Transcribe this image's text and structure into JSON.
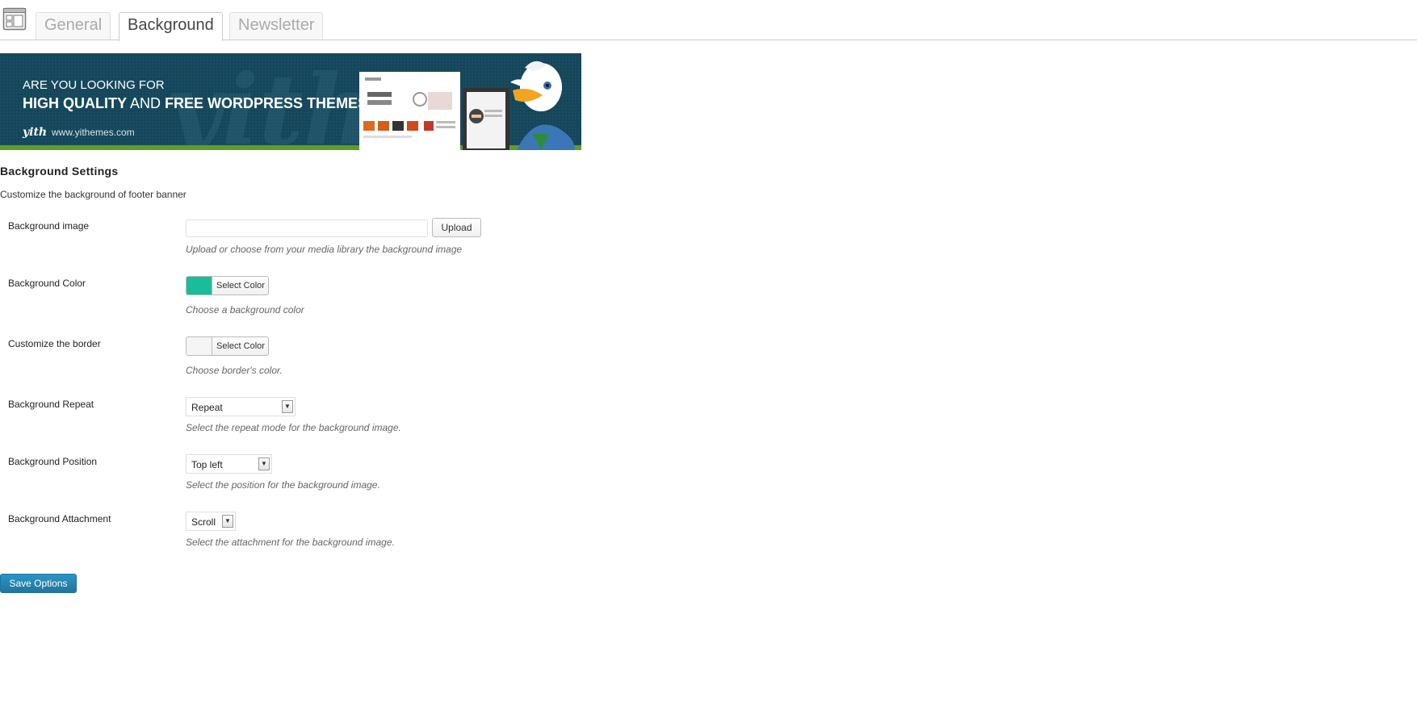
{
  "tabs": [
    {
      "label": "General",
      "active": false
    },
    {
      "label": "Background",
      "active": true
    },
    {
      "label": "Newsletter",
      "active": false
    }
  ],
  "tabs_icon": "layout-icon",
  "banner": {
    "line1": "ARE YOU LOOKING FOR",
    "line2_part1": "HIGH QUALITY",
    "line2_part2": "AND",
    "line2_part3": "FREE WORDPRESS THEMES?",
    "logo": "yith",
    "url": "www.yithemes.com",
    "watermark": "yith"
  },
  "settings": {
    "title": "Background Settings",
    "description": "Customize the background of footer banner",
    "background_image": {
      "label": "Background image",
      "value": "",
      "button": "Upload",
      "help": "Upload or choose from your media library the background image"
    },
    "background_color": {
      "label": "Background Color",
      "color": "#1abc9c",
      "button": "Select Color",
      "help": "Choose a background color"
    },
    "border": {
      "label": "Customize the border",
      "color": "#f5f5f5",
      "button": "Select Color",
      "help": "Choose border's color."
    },
    "repeat": {
      "label": "Background Repeat",
      "value": "Repeat",
      "help": "Select the repeat mode for the background image."
    },
    "position": {
      "label": "Background Position",
      "value": "Top left",
      "help": "Select the position for the background image."
    },
    "attachment": {
      "label": "Background Attachment",
      "value": "Scroll",
      "help": "Select the attachment for the background image."
    }
  },
  "save_button": "Save Options",
  "colors": {
    "primary_button": "#21759b",
    "banner_background": "#16465a",
    "banner_stripe": "#5f9d23"
  }
}
